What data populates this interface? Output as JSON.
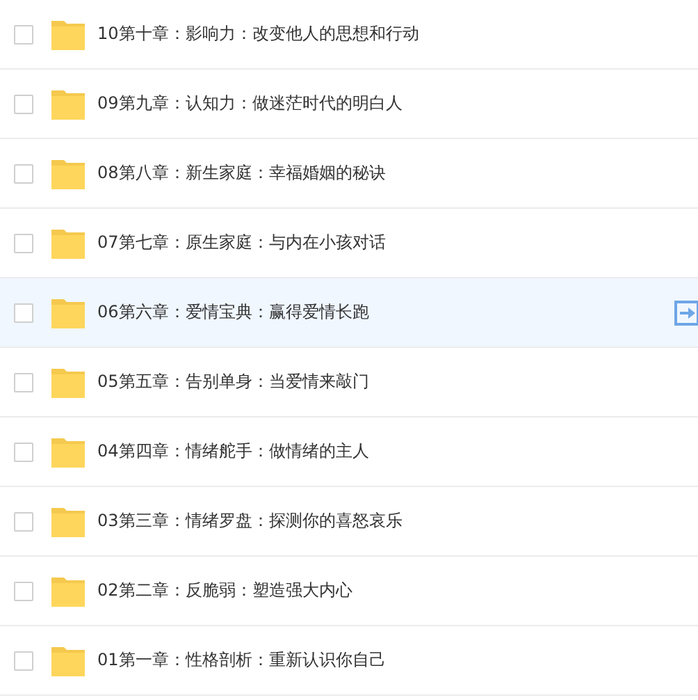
{
  "folders": [
    {
      "name": "10第十章：影响力：改变他人的思想和行动",
      "checked": false,
      "highlighted": false
    },
    {
      "name": "09第九章：认知力：做迷茫时代的明白人",
      "checked": false,
      "highlighted": false
    },
    {
      "name": "08第八章：新生家庭：幸福婚姻的秘诀",
      "checked": false,
      "highlighted": false
    },
    {
      "name": "07第七章：原生家庭：与内在小孩对话",
      "checked": false,
      "highlighted": false
    },
    {
      "name": "06第六章：爱情宝典：赢得爱情长跑",
      "checked": false,
      "highlighted": true
    },
    {
      "name": "05第五章：告别单身：当爱情来敲门",
      "checked": false,
      "highlighted": false
    },
    {
      "name": "04第四章：情绪舵手：做情绪的主人",
      "checked": false,
      "highlighted": false
    },
    {
      "name": "03第三章：情绪罗盘：探测你的喜怒哀乐",
      "checked": false,
      "highlighted": false
    },
    {
      "name": "02第二章：反脆弱：塑造强大内心",
      "checked": false,
      "highlighted": false
    },
    {
      "name": "01第一章：性格剖析：重新认识你自己",
      "checked": false,
      "highlighted": false
    }
  ]
}
